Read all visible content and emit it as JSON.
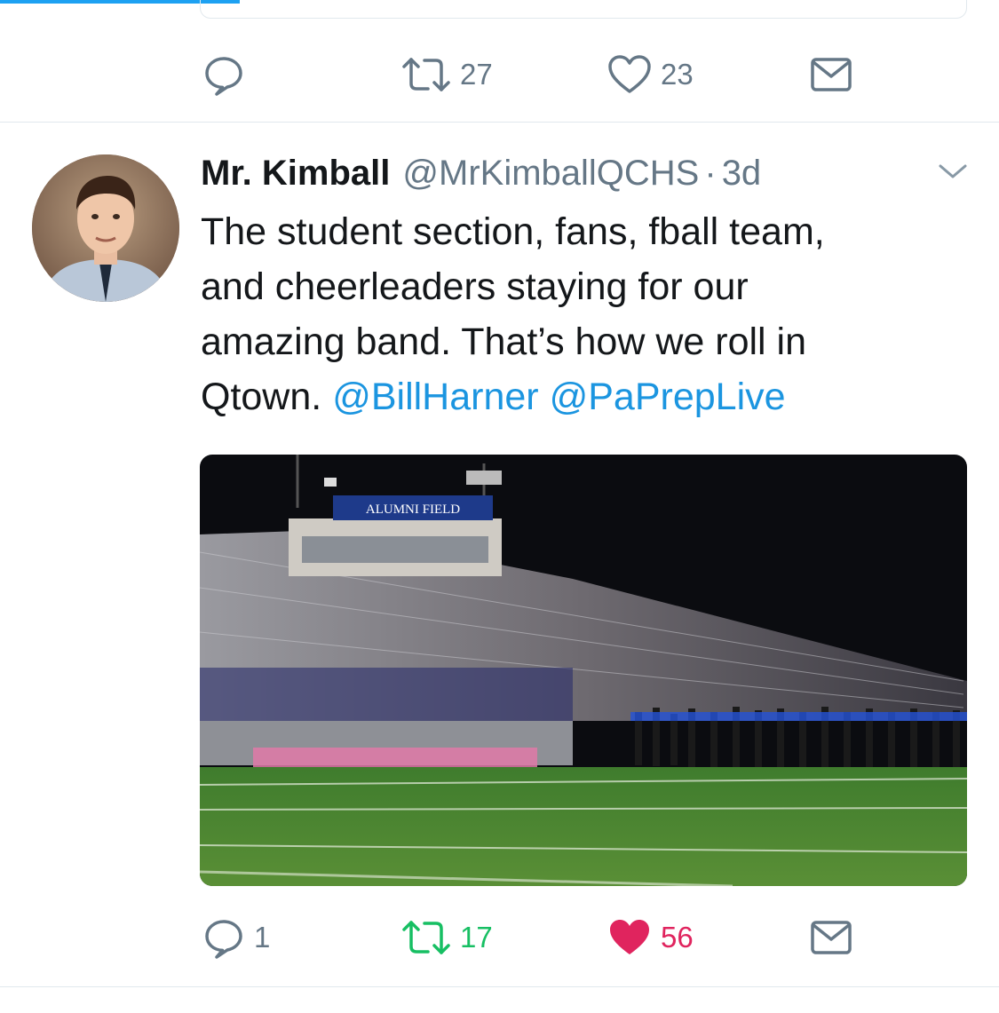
{
  "previous_tweet": {
    "actions": {
      "reply_count": "",
      "retweet_count": "27",
      "like_count": "23"
    }
  },
  "tweet": {
    "author_name": "Mr. Kimball",
    "handle": "@MrKimballQCHS",
    "separator": "·",
    "time": "3d",
    "text_lines": [
      "The student section, fans, fball team,",
      "and cheerleaders staying for our",
      "amazing band. That’s how we roll in"
    ],
    "text_last_prefix": "Qtown.",
    "mentions": [
      "@BillHarner",
      "@PaPrepLive"
    ],
    "media": {
      "sign_text": "ALUMNI   FIELD"
    },
    "actions": {
      "reply_count": "1",
      "retweet_count": "17",
      "like_count": "56"
    }
  },
  "colors": {
    "accent": "#1da1f2",
    "mention": "#1b95e0",
    "retweet_active": "#17bf63",
    "like_active": "#e0245e",
    "muted": "#657786"
  },
  "icons": [
    "reply-icon",
    "retweet-icon",
    "like-icon",
    "direct-message-icon",
    "chevron-down-icon"
  ]
}
